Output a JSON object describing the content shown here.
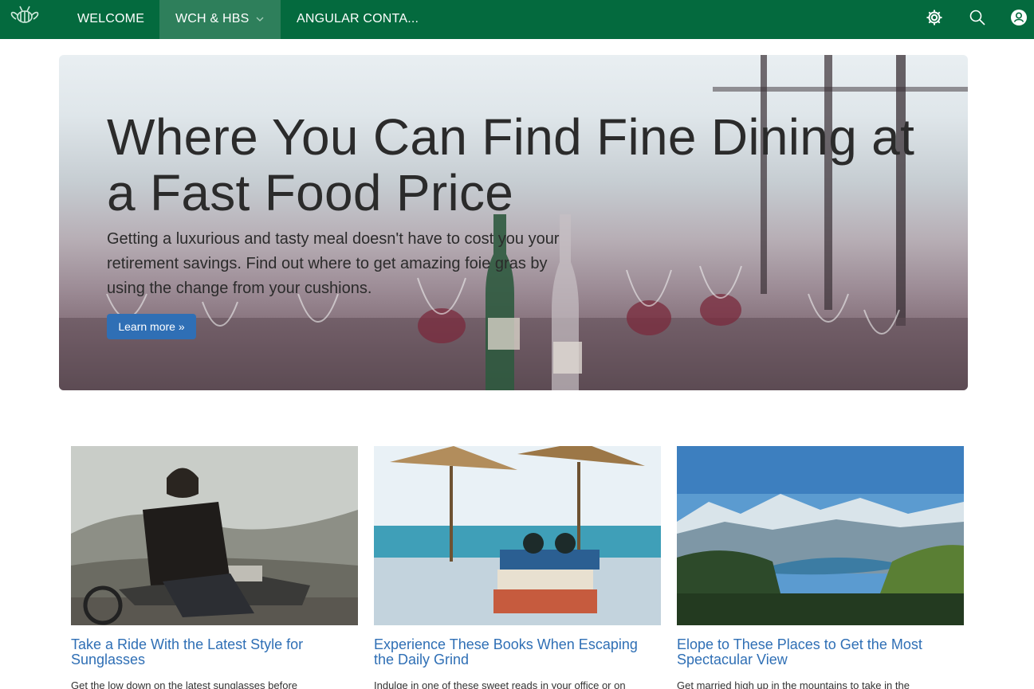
{
  "nav": {
    "logo_icon": "bee-logo-icon",
    "items": [
      {
        "label": "WELCOME"
      },
      {
        "label": "WCH & HBS"
      },
      {
        "label": "ANGULAR CONTA..."
      }
    ],
    "active_background": "#2e7f5b",
    "bar_color": "#046a3e",
    "icons": [
      "gear-icon",
      "search-icon",
      "user-icon"
    ]
  },
  "hero": {
    "title": "Where You Can Find Fine Dining at a Fast Food Price",
    "text": "Getting a luxurious and tasty meal doesn't have to cost you your retirement savings. Find out where to get amazing foie gras by using the change from your cushions.",
    "button_label": "Learn more »",
    "button_color": "#2f6fb5"
  },
  "cards": [
    {
      "title": "Take a Ride With the Latest Style for Sunglasses",
      "text": "Get the low down on the latest sunglasses before",
      "image": "man-on-motorcycle"
    },
    {
      "title": "Experience These Books When Escaping the Daily Grind",
      "text": "Indulge in one of these sweet reads in your office or on",
      "image": "books-on-beach"
    },
    {
      "title": "Elope to These Places to Get the Most Spectacular View",
      "text": "Get married high up in the mountains to take in the",
      "image": "mountain-lake"
    }
  ],
  "link_color": "#2f6fb5"
}
